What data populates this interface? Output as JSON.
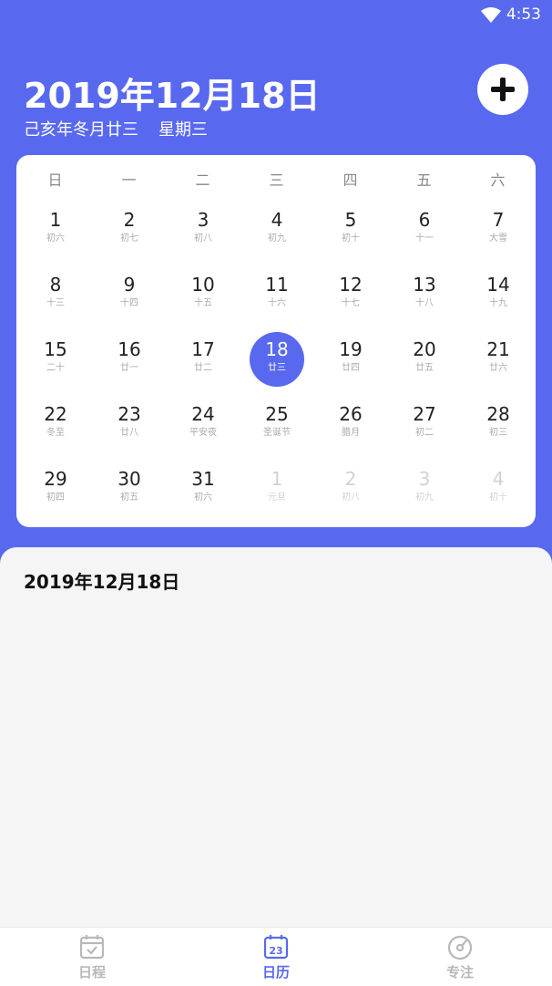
{
  "status_bar": {
    "time": "4:53"
  },
  "header": {
    "title": "2019年12月18日",
    "lunar": "己亥年冬月廿三",
    "weekday": "星期三"
  },
  "weekdays": [
    "日",
    "一",
    "二",
    "三",
    "四",
    "五",
    "六"
  ],
  "calendar": {
    "weeks": [
      [
        {
          "n": "1",
          "l": "初六"
        },
        {
          "n": "2",
          "l": "初七"
        },
        {
          "n": "3",
          "l": "初八"
        },
        {
          "n": "4",
          "l": "初九"
        },
        {
          "n": "5",
          "l": "初十"
        },
        {
          "n": "6",
          "l": "十一"
        },
        {
          "n": "7",
          "l": "大雪"
        }
      ],
      [
        {
          "n": "8",
          "l": "十三"
        },
        {
          "n": "9",
          "l": "十四"
        },
        {
          "n": "10",
          "l": "十五"
        },
        {
          "n": "11",
          "l": "十六"
        },
        {
          "n": "12",
          "l": "十七"
        },
        {
          "n": "13",
          "l": "十八"
        },
        {
          "n": "14",
          "l": "十九"
        }
      ],
      [
        {
          "n": "15",
          "l": "二十"
        },
        {
          "n": "16",
          "l": "廿一"
        },
        {
          "n": "17",
          "l": "廿二"
        },
        {
          "n": "18",
          "l": "廿三",
          "selected": true
        },
        {
          "n": "19",
          "l": "廿四"
        },
        {
          "n": "20",
          "l": "廿五"
        },
        {
          "n": "21",
          "l": "廿六"
        }
      ],
      [
        {
          "n": "22",
          "l": "冬至"
        },
        {
          "n": "23",
          "l": "廿八"
        },
        {
          "n": "24",
          "l": "平安夜"
        },
        {
          "n": "25",
          "l": "圣诞节"
        },
        {
          "n": "26",
          "l": "腊月"
        },
        {
          "n": "27",
          "l": "初二"
        },
        {
          "n": "28",
          "l": "初三"
        }
      ],
      [
        {
          "n": "29",
          "l": "初四"
        },
        {
          "n": "30",
          "l": "初五"
        },
        {
          "n": "31",
          "l": "初六"
        },
        {
          "n": "1",
          "l": "元旦",
          "muted": true
        },
        {
          "n": "2",
          "l": "初八",
          "muted": true
        },
        {
          "n": "3",
          "l": "初九",
          "muted": true
        },
        {
          "n": "4",
          "l": "初十",
          "muted": true
        }
      ]
    ]
  },
  "detail": {
    "date": "2019年12月18日"
  },
  "tabs": [
    {
      "label": "日程",
      "icon": "calendar-check-icon"
    },
    {
      "label": "日历",
      "icon": "calendar-23-icon",
      "active": true
    },
    {
      "label": "专注",
      "icon": "focus-dial-icon"
    }
  ],
  "colors": {
    "accent": "#5869f0",
    "background": "#f5f5f5",
    "inactive": "#b8b8b8"
  }
}
